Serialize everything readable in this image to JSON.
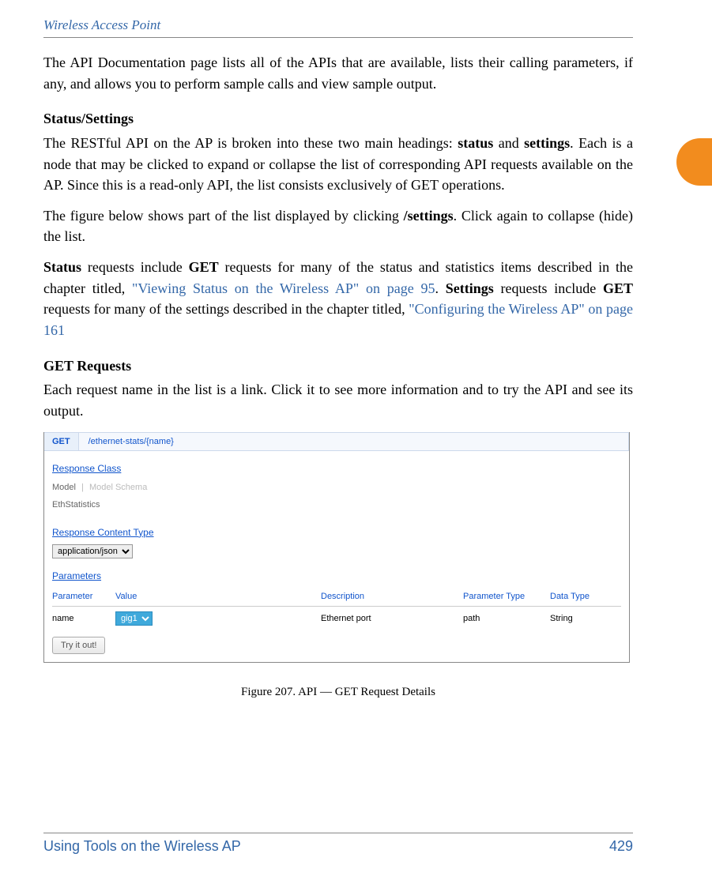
{
  "header": {
    "title": "Wireless Access Point"
  },
  "intro": "The API Documentation page lists all of the APIs that are available, lists their calling parameters, if any, and allows you to perform sample calls and view sample output.",
  "status_settings": {
    "heading": "Status/Settings",
    "part1a": "The RESTful API on the AP is broken into these two main headings: ",
    "bold1": "status",
    "part1b": " and ",
    "bold2": "settings",
    "part1c": ". Each is a node that may be clicked to expand or collapse the list of corresponding API requests available on the AP. Since this is a read-only API, the list consists exclusively of GET operations.",
    "part2a": "The figure below shows part of the list displayed by clicking ",
    "bold3": "/settings",
    "part2b": ". Click again to collapse (hide) the list.",
    "part3a": "Status",
    "part3b": " requests include ",
    "bold4": "GET",
    "part3c": " requests for many of the status and statistics items described in the chapter titled, ",
    "link1": "\"Viewing Status on the Wireless AP\" on page 95",
    "part3d": ". ",
    "bold5": "Settings",
    "part3e": " requests include ",
    "bold6": "GET",
    "part3f": " requests for many of the settings described in the chapter titled, ",
    "link2": "\"Configuring the Wireless AP\" on page 161"
  },
  "get_requests": {
    "heading": "GET Requests",
    "body": "Each request name in the list is a link. Click it to see more information and to try the API and see its output."
  },
  "ui": {
    "method": "GET",
    "path": "/ethernet-stats/{name}",
    "response_class": "Response Class",
    "model_tab": "Model",
    "model_schema_tab": "Model Schema",
    "model_name": "EthStatistics",
    "response_content_type": "Response Content Type",
    "content_type_value": "application/json",
    "parameters_label": "Parameters",
    "columns": {
      "c1": "Parameter",
      "c2": "Value",
      "c3": "Description",
      "c4": "Parameter Type",
      "c5": "Data Type"
    },
    "row": {
      "param": "name",
      "value_selected": "gig1",
      "description": "Ethernet port",
      "ptype": "path",
      "dtype": "String"
    },
    "try_label": "Try it out!"
  },
  "figure_caption": "Figure 207. API — GET Request Details",
  "footer": {
    "left": "Using Tools on the Wireless AP",
    "right": "429"
  }
}
